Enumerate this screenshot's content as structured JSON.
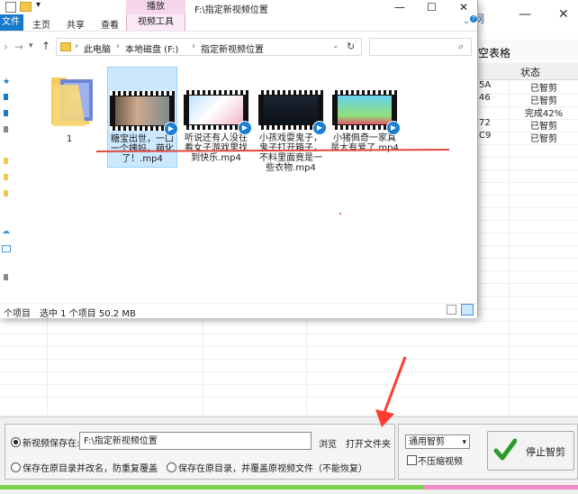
{
  "background_app": {
    "title": "网",
    "toolbar_label": "空表格",
    "status_header": "状态",
    "rows": [
      {
        "col": "5A",
        "status": "已智剪"
      },
      {
        "col": "46",
        "status": "已智剪"
      },
      {
        "col": "",
        "status": "完成42%"
      },
      {
        "col": "72",
        "status": "已智剪"
      },
      {
        "col": "C9",
        "status": "已智剪"
      }
    ],
    "save_label": "新视频保存在:",
    "save_path": "F:\\指定新视频位置",
    "browse": "浏览",
    "open_folder": "打开文件夹",
    "option_rename": "保存在原目录并改名，防重复覆盖",
    "option_overwrite": "保存在原目录，并覆盖原视频文件（不能恢复）",
    "mode_value": "通用智剪",
    "no_compress": "不压缩视频",
    "stop_button": "停止智剪"
  },
  "explorer": {
    "title_path": "F:\\指定新视频位置",
    "tab_play": "播放",
    "ribbon_tabs": [
      "文件",
      "主页",
      "共享",
      "查看"
    ],
    "tab_video_tools": "视频工具",
    "breadcrumb": [
      "此电脑",
      "本地磁盘 (F:)",
      "指定新视频位置"
    ],
    "items": [
      {
        "name": "1",
        "kind": "folder"
      },
      {
        "name": "糖宝出世，一口一个姨妈，萌化了！.mp4",
        "kind": "video",
        "selected": true
      },
      {
        "name": "听说还有人没在看女子游戏里找到快乐.mp4",
        "kind": "video",
        "selected": false
      },
      {
        "name": "小孩戏耍鬼子，鬼子打开箱子，不料里面竟是一些衣物.mp4",
        "kind": "video",
        "selected": false
      },
      {
        "name": "小猪佩奇一家真是太有爱了.mp4",
        "kind": "video",
        "selected": false
      }
    ],
    "status_count": "个项目",
    "status_selected": "选中 1 个项目  50.2 MB"
  }
}
